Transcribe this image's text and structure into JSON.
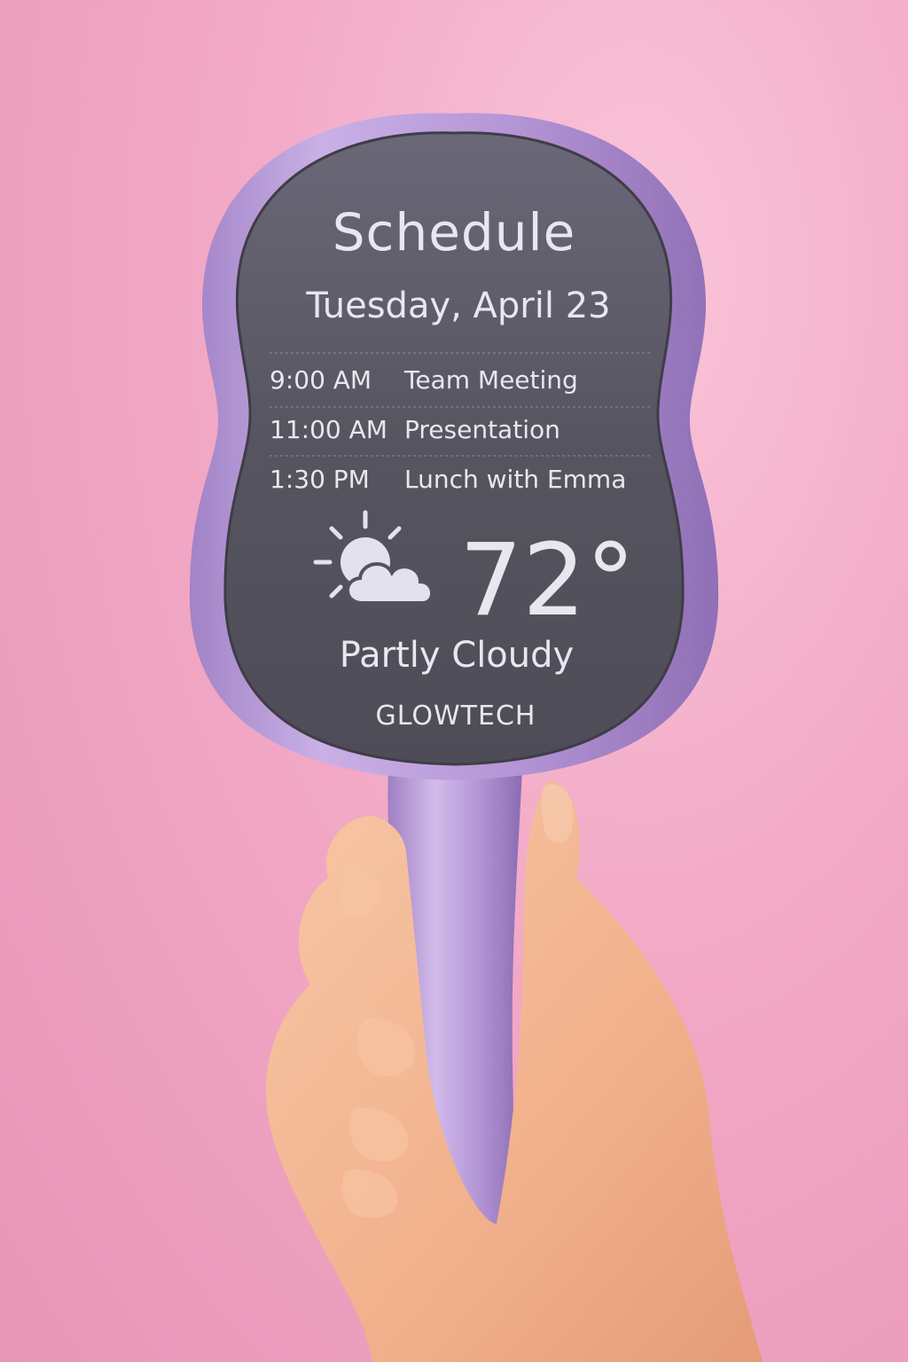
{
  "screen": {
    "title": "Schedule",
    "date": "Tuesday, April 23",
    "events": [
      {
        "time": "9:00 AM",
        "name": "Team Meeting"
      },
      {
        "time": "11:00 AM",
        "name": "Presentation"
      },
      {
        "time": "1:30 PM",
        "name": "Lunch with Emma"
      }
    ],
    "weather": {
      "icon": "partly-cloudy-icon",
      "temperature": "72°",
      "condition": "Partly Cloudy"
    },
    "brand": "GLOWTECH"
  },
  "colors": {
    "background": "#f2a9c6",
    "device": "#b79ad6",
    "screen": "#54525f",
    "screen_text": "#e8e6ee",
    "skin": "#f4b894"
  }
}
